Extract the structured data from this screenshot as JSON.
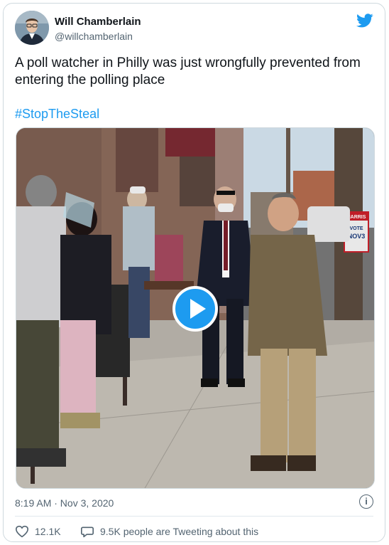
{
  "author": {
    "name": "Will Chamberlain",
    "handle": "@willchamberlain"
  },
  "tweet": {
    "text": "A poll watcher in Philly was just wrongfully prevented from entering the polling place",
    "hashtag": "#StopTheSteal",
    "timestamp": "8:19 AM · Nov 3, 2020"
  },
  "media": {
    "sign_top": "HARRIS",
    "sign_mid": "VOTE",
    "sign_date": "NOV3"
  },
  "stats": {
    "likes": "12.1K",
    "conversation": "9.5K people are Tweeting about this"
  },
  "icons": {
    "info": "i"
  },
  "colors": {
    "accent": "#1d9bf0",
    "muted": "#536471",
    "border": "#cfd9de"
  }
}
